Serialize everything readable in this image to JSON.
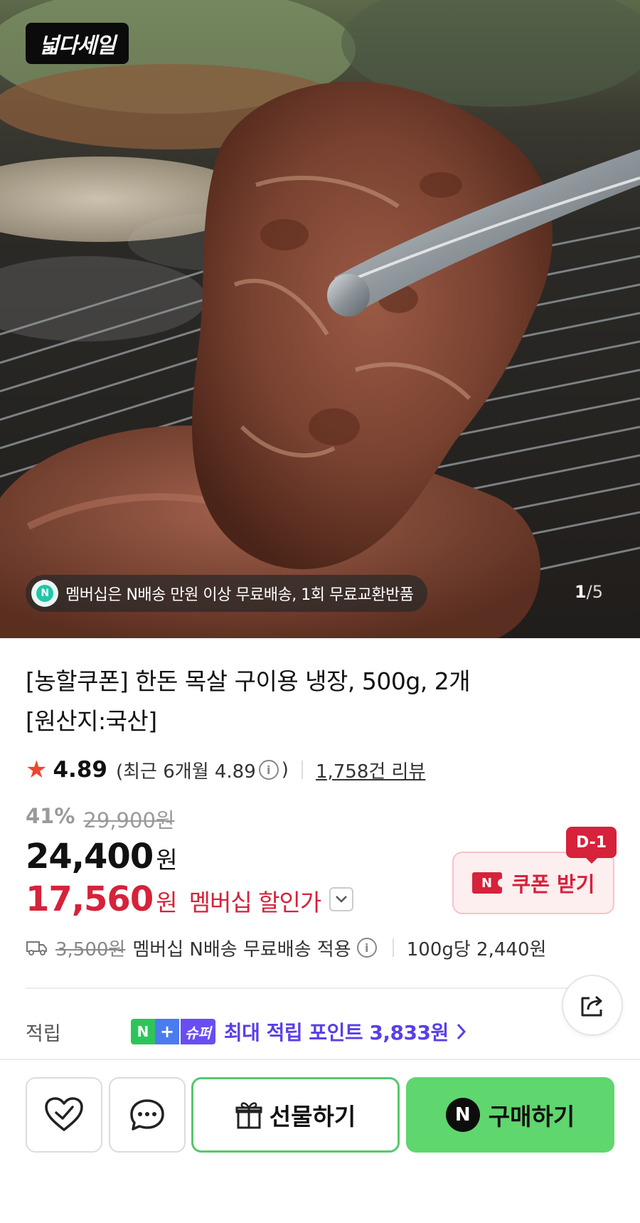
{
  "hero": {
    "brand_badge": "넓다세일",
    "promo_text": "멤버십은 N배송 만원 이상 무료배송, 1회 무료교환반품",
    "promo_icon_letter": "N",
    "pager_current": "1",
    "pager_total": "/5"
  },
  "product": {
    "title_line1": "[농할쿠폰] 한돈 목살 구이용 냉장, 500g, 2개",
    "title_line2": "[원산지:국산]",
    "rating": "4.89",
    "rating_recent": "(최근 6개월 4.89",
    "rating_recent_close": ")",
    "review_count": "1,758건 리뷰"
  },
  "price": {
    "discount_pct": "41%",
    "original": "29,900원",
    "sale": "24,400",
    "sale_unit": "원",
    "member": "17,560",
    "member_unit": "원",
    "member_label": "멤버십 할인가"
  },
  "coupon": {
    "dday": "D-1",
    "ticket_letter": "N",
    "label": "쿠폰 받기"
  },
  "shipping": {
    "fee_strike": "3,500원",
    "text": "멤버십 N배송 무료배송 적용",
    "unit_price": "100g당 2,440원"
  },
  "points": {
    "label": "적립",
    "chip_n": "N",
    "chip_plus": "+",
    "chip_super": "슈퍼",
    "text": "최대 적립 포인트 3,833원"
  },
  "actions": {
    "gift_label": "선물하기",
    "buy_label": "구매하기",
    "buy_icon_letter": "N"
  },
  "colors": {
    "accent_red": "#d6223a",
    "rating_star": "#f2442e",
    "points_purple": "#5b3ee8",
    "buy_green": "#5fd66e"
  }
}
